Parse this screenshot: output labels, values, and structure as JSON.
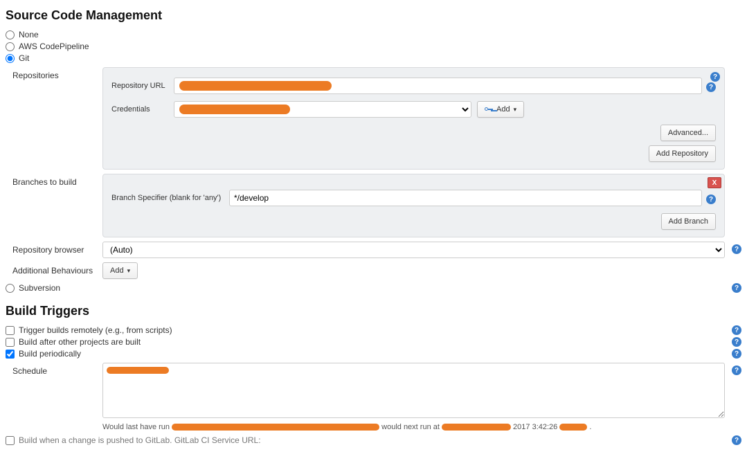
{
  "scm": {
    "title": "Source Code Management",
    "options": {
      "none": "None",
      "aws": "AWS CodePipeline",
      "git": "Git",
      "svn": "Subversion"
    },
    "selected": "git",
    "git": {
      "repositories_label": "Repositories",
      "repo_url_label": "Repository URL",
      "repo_url_value": "",
      "credentials_label": "Credentials",
      "credentials_value": "",
      "add_btn": "Add",
      "advanced_btn": "Advanced...",
      "add_repo_btn": "Add Repository",
      "branches_label": "Branches to build",
      "branch_spec_label": "Branch Specifier (blank for 'any')",
      "branch_spec_value": "*/develop",
      "add_branch_btn": "Add Branch",
      "repo_browser_label": "Repository browser",
      "repo_browser_value": "(Auto)",
      "behaviours_label": "Additional Behaviours",
      "behaviours_add": "Add"
    }
  },
  "triggers": {
    "title": "Build Triggers",
    "remote": {
      "label": "Trigger builds remotely (e.g., from scripts)",
      "checked": false
    },
    "after": {
      "label": "Build after other projects are built",
      "checked": false
    },
    "periodic": {
      "label": "Build periodically",
      "checked": true
    },
    "schedule_label": "Schedule",
    "schedule_value": "",
    "hint_prefix": "Would last have run ",
    "hint_mid": " would next run at ",
    "hint_tail": "2017 3:42:26",
    "gitlab_label": "Build when a change is pushed to GitLab. GitLab CI Service URL:"
  }
}
